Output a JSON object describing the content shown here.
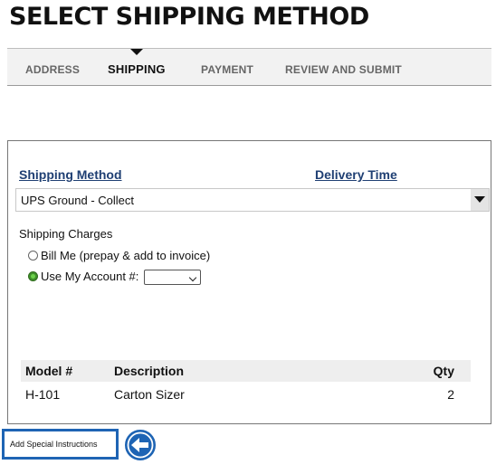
{
  "page": {
    "title": "SELECT SHIPPING METHOD"
  },
  "steps": [
    {
      "label": "ADDRESS",
      "active": false
    },
    {
      "label": "SHIPPING",
      "active": true
    },
    {
      "label": "PAYMENT",
      "active": false
    },
    {
      "label": "REVIEW AND SUBMIT",
      "active": false
    }
  ],
  "shipping": {
    "method_header": "Shipping Method",
    "delivery_header": "Delivery Time",
    "selected_method": "UPS Ground - Collect",
    "charges_label": "Shipping Charges",
    "options": [
      {
        "label": "Bill Me (prepay & add to invoice)",
        "selected": false
      },
      {
        "label": "Use My Account #:",
        "selected": true
      }
    ],
    "account_value": ""
  },
  "items": {
    "headers": [
      "Model #",
      "Description",
      "Qty"
    ],
    "rows": [
      [
        "H-101",
        "Carton Sizer",
        "2"
      ]
    ]
  },
  "instructions": {
    "label": "Add Special Instructions"
  },
  "colors": {
    "accent_blue": "#1e64b4",
    "link_navy": "#1f3f73",
    "radio_green": "#3f8f2a"
  },
  "icons": {
    "callout_arrow": "left-arrow-icon"
  }
}
